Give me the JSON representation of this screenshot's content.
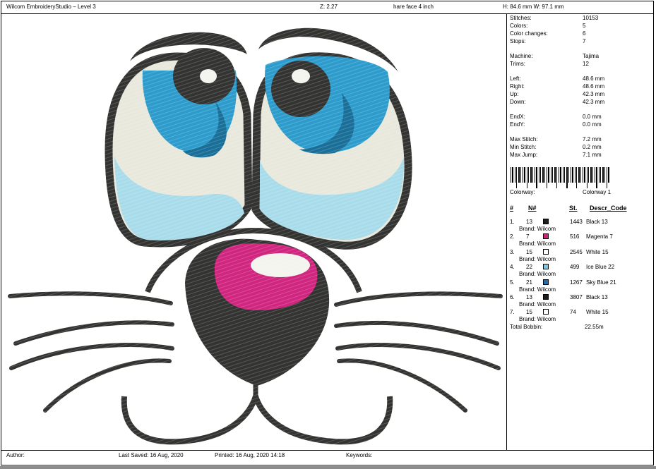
{
  "header": {
    "title": "Wilcom EmbroideryStudio – Level 3",
    "zoom": "Z: 2.27",
    "design_name": "hare face 4 inch",
    "dimensions": "H: 84.6 mm   W: 97.1 mm"
  },
  "stats": [
    {
      "label": "Stitches:",
      "value": "10153"
    },
    {
      "label": "Colors:",
      "value": "5"
    },
    {
      "label": "Color changes:",
      "value": "6"
    },
    {
      "label": "Stops:",
      "value": "7"
    },
    {
      "label": "Machine:",
      "value": "Tajima"
    },
    {
      "label": "Trims:",
      "value": "12"
    },
    {
      "label": "Left:",
      "value": "48.6 mm"
    },
    {
      "label": "Right:",
      "value": "48.6 mm"
    },
    {
      "label": "Up:",
      "value": "42.3 mm"
    },
    {
      "label": "Down:",
      "value": "42.3 mm"
    },
    {
      "label": "EndX:",
      "value": "0.0 mm"
    },
    {
      "label": "EndY:",
      "value": "0.0 mm"
    },
    {
      "label": "Max Stitch:",
      "value": "7.2 mm"
    },
    {
      "label": "Min Stitch:",
      "value": "0.2 mm"
    },
    {
      "label": "Max Jump:",
      "value": "7.1 mm"
    }
  ],
  "colorway": {
    "label": "Colorway:",
    "value": "Colorway 1"
  },
  "color_table": {
    "headers": {
      "num": "#",
      "needle": "N#",
      "stitches": "St.",
      "descr": "Descr_Code"
    },
    "rows": [
      {
        "num": "1.",
        "needle": "13",
        "swatch": "#1e1e1e",
        "stitches": "1443",
        "descr": "Black 13",
        "brand": "Brand: Wilcom"
      },
      {
        "num": "2.",
        "needle": "7",
        "swatch": "#c8267a",
        "stitches": "516",
        "descr": "Magenta 7",
        "brand": "Brand: Wilcom"
      },
      {
        "num": "3.",
        "needle": "15",
        "swatch": "#ffffff",
        "stitches": "2545",
        "descr": "White 15",
        "brand": "Brand: Wilcom"
      },
      {
        "num": "4.",
        "needle": "22",
        "swatch": "#7ec8e3",
        "stitches": "499",
        "descr": "Ice Blue 22",
        "brand": "Brand: Wilcom"
      },
      {
        "num": "5.",
        "needle": "21",
        "swatch": "#1f6fae",
        "stitches": "1267",
        "descr": "Sky Blue 21",
        "brand": "Brand: Wilcom"
      },
      {
        "num": "6.",
        "needle": "13",
        "swatch": "#1e1e1e",
        "stitches": "3807",
        "descr": "Black 13",
        "brand": "Brand: Wilcom"
      },
      {
        "num": "7.",
        "needle": "15",
        "swatch": "#ffffff",
        "stitches": "74",
        "descr": "White 15",
        "brand": "Brand: Wilcom"
      }
    ]
  },
  "total_bobbin": {
    "label": "Total Bobbin:",
    "value": "22.55m"
  },
  "footer": {
    "author": "Author:",
    "last_saved": "Last Saved: 16 Aug, 2020",
    "printed": "Printed: 16 Aug, 2020 14:18",
    "keywords": "Keywords:"
  },
  "design_colors": {
    "outline": "#333331",
    "iris": "#2d9ccc",
    "iris_dark": "#1a6f98",
    "sclera": "#e8e8dc",
    "ice": "#a8dcea",
    "magenta": "#d0267f",
    "white": "#f4f4ee"
  }
}
